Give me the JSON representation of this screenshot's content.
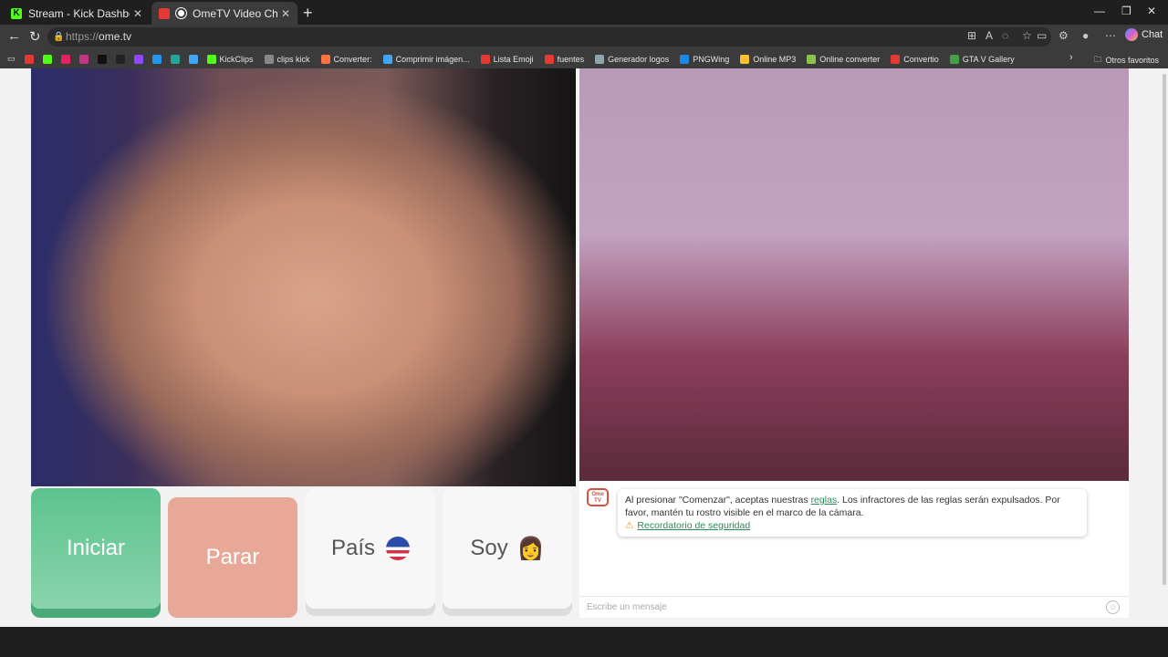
{
  "tabs": [
    {
      "title": "Stream - Kick Dashboard"
    },
    {
      "title": "OmeTV Video Chat — Omegl..."
    }
  ],
  "address": {
    "scheme": "https://",
    "host": "ome.tv"
  },
  "toolbar": {
    "chat_label": "Chat"
  },
  "favorites": [
    {
      "label": "",
      "color": "#e53935"
    },
    {
      "label": "",
      "color": "#53fc18"
    },
    {
      "label": "",
      "color": "#e91e63"
    },
    {
      "label": "",
      "color": "#c13584"
    },
    {
      "label": "",
      "color": "#111111"
    },
    {
      "label": "",
      "color": "#222222"
    },
    {
      "label": "",
      "color": "#9146ff"
    },
    {
      "label": "",
      "color": "#2196f3"
    },
    {
      "label": "",
      "color": "#26a69a"
    },
    {
      "label": "",
      "color": "#42a5f5"
    },
    {
      "label": "KickClips",
      "color": "#53fc18"
    },
    {
      "label": "clips kick",
      "color": "#888888"
    },
    {
      "label": "Converter:",
      "color": "#ff7043"
    },
    {
      "label": "Comprimir imágen...",
      "color": "#42a5f5"
    },
    {
      "label": "Lista Emoji",
      "color": "#e53935"
    },
    {
      "label": "fuentes",
      "color": "#e53935"
    },
    {
      "label": "Generador logos",
      "color": "#90a4ae"
    },
    {
      "label": "PNGWing",
      "color": "#1e88e5"
    },
    {
      "label": "Online MP3",
      "color": "#fbc02d"
    },
    {
      "label": "Online converter",
      "color": "#8bc34a"
    },
    {
      "label": "Convertio",
      "color": "#e53935"
    },
    {
      "label": "GTA V Gallery",
      "color": "#43a047"
    }
  ],
  "favorites_other": "Otros favoritos",
  "buttons": {
    "start": "Iniciar",
    "stop": "Parar",
    "country": "País",
    "gender": "Soy",
    "gender_emoji": "👩"
  },
  "chat": {
    "logo": "Ome TV",
    "notice_pre": "Al presionar \"Comenzar\", aceptas nuestras ",
    "notice_link": "reglas",
    "notice_post": ". Los infractores de las reglas serán expulsados. Por favor, mantén tu rostro visible en el marco de la cámara.",
    "safety_link": "Recordatorio de seguridad",
    "input_placeholder": "Escribe un mensaje"
  }
}
